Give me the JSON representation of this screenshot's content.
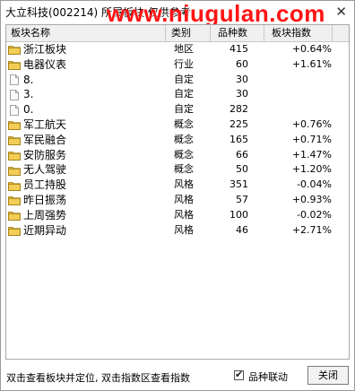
{
  "window": {
    "title": "大立科技(002214)  所属板块 仅供参考",
    "watermark": "www.niugulan.com",
    "close_symbol": "✕"
  },
  "columns": {
    "name": "板块名称",
    "category": "类别",
    "count": "品种数",
    "index": "板块指数"
  },
  "colors": {
    "folder": "#e8b830",
    "watermark": "#ff1414"
  },
  "rows": [
    {
      "icon": "folder-icon",
      "name": "浙江板块",
      "category": "地区",
      "count": "415",
      "change": "+0.64%"
    },
    {
      "icon": "folder-icon",
      "name": "电器仪表",
      "category": "行业",
      "count": "60",
      "change": "+1.61%"
    },
    {
      "icon": "document-icon",
      "name": "8.",
      "category": "自定",
      "count": "30",
      "change": ""
    },
    {
      "icon": "document-icon",
      "name": "3.",
      "category": "自定",
      "count": "30",
      "change": ""
    },
    {
      "icon": "document-icon",
      "name": "0.",
      "category": "自定",
      "count": "282",
      "change": ""
    },
    {
      "icon": "folder-icon",
      "name": "军工航天",
      "category": "概念",
      "count": "225",
      "change": "+0.76%"
    },
    {
      "icon": "folder-icon",
      "name": "军民融合",
      "category": "概念",
      "count": "165",
      "change": "+0.71%"
    },
    {
      "icon": "folder-icon",
      "name": "安防服务",
      "category": "概念",
      "count": "66",
      "change": "+1.47%"
    },
    {
      "icon": "folder-icon",
      "name": "无人驾驶",
      "category": "概念",
      "count": "50",
      "change": "+1.20%"
    },
    {
      "icon": "folder-icon",
      "name": "员工持股",
      "category": "风格",
      "count": "351",
      "change": "-0.04%"
    },
    {
      "icon": "folder-icon",
      "name": "昨日振荡",
      "category": "风格",
      "count": "57",
      "change": "+0.93%"
    },
    {
      "icon": "folder-icon",
      "name": "上周强势",
      "category": "风格",
      "count": "100",
      "change": "-0.02%"
    },
    {
      "icon": "folder-icon",
      "name": "近期异动",
      "category": "风格",
      "count": "46",
      "change": "+2.71%"
    }
  ],
  "footer": {
    "hint": "双击查看板块并定位, 双击指数区查看指数",
    "checkbox_label": "品种联动",
    "checkbox_checked": true,
    "close_button": "关闭"
  }
}
